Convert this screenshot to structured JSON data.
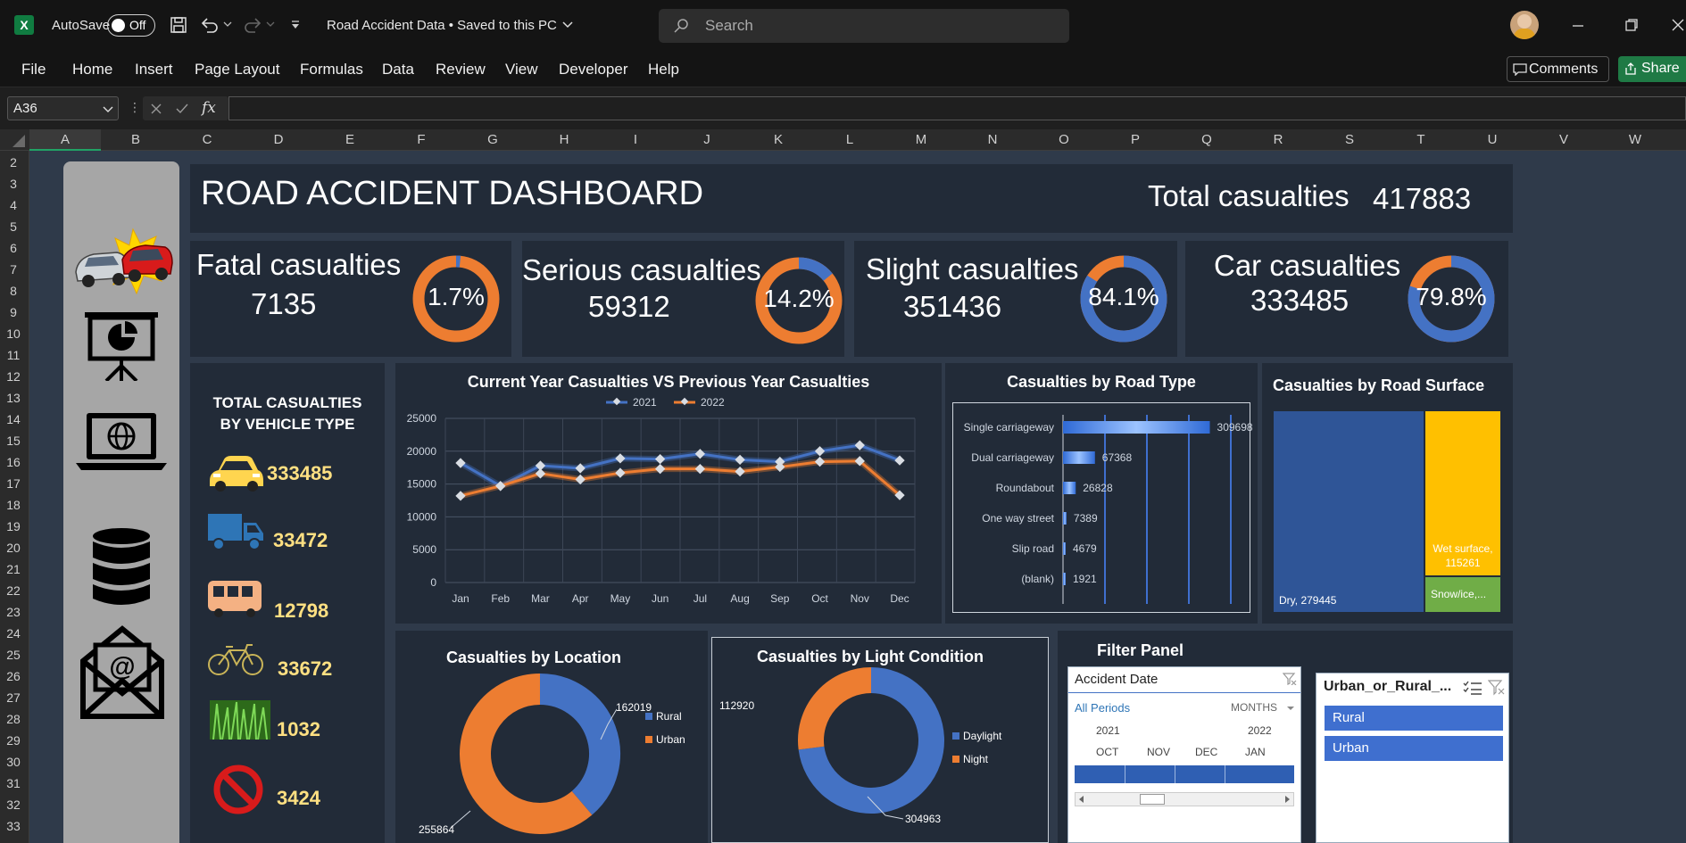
{
  "titlebar": {
    "app_icon": "excel-icon",
    "autosave_label": "AutoSave",
    "autosave_state": "Off",
    "doc_title": "Road Accident Data • Saved to this PC",
    "search_placeholder": "Search"
  },
  "ribbon": {
    "menu": [
      "File",
      "Home",
      "Insert",
      "Page Layout",
      "Formulas",
      "Data",
      "Review",
      "View",
      "Developer",
      "Help"
    ],
    "comments_label": "Comments",
    "share_label": "Share"
  },
  "formula": {
    "name_box": "A36",
    "fx": "fx",
    "value": ""
  },
  "columns": [
    "A",
    "B",
    "C",
    "D",
    "E",
    "F",
    "G",
    "H",
    "I",
    "J",
    "K",
    "L",
    "M",
    "N",
    "O",
    "P",
    "Q",
    "R",
    "S",
    "T",
    "U",
    "V",
    "W"
  ],
  "rows": [
    "2",
    "3",
    "4",
    "5",
    "6",
    "7",
    "8",
    "9",
    "10",
    "11",
    "12",
    "13",
    "14",
    "15",
    "16",
    "17",
    "18",
    "19",
    "20",
    "21",
    "22",
    "23",
    "24",
    "25",
    "26",
    "27",
    "28",
    "29",
    "30",
    "31",
    "32",
    "33"
  ],
  "dashboard": {
    "title": "ROAD ACCIDENT DASHBOARD",
    "total_label": "Total casualties",
    "total_value": "417883",
    "kpis": [
      {
        "label": "Fatal casualties",
        "value": "7135",
        "pct_label": "1.7%",
        "pct": 1.7
      },
      {
        "label": "Serious casualties",
        "value": "59312",
        "pct_label": "14.2%",
        "pct": 14.2
      },
      {
        "label": "Slight casualties",
        "value": "351436",
        "pct_label": "84.1%",
        "pct": 84.1
      },
      {
        "label": "Car casualties",
        "value": "333485",
        "pct_label": "79.8%",
        "pct": 79.8
      }
    ],
    "vehicle_title_1": "TOTAL CASUALTIES",
    "vehicle_title_2": "BY VEHICLE TYPE",
    "vehicles": [
      {
        "icon": "car-icon",
        "value": "333485"
      },
      {
        "icon": "truck-icon",
        "value": "33472"
      },
      {
        "icon": "bus-icon",
        "value": "12798"
      },
      {
        "icon": "bicycle-icon",
        "value": "33672"
      },
      {
        "icon": "grass-icon",
        "value": "1032"
      },
      {
        "icon": "no-entry-icon",
        "value": "3424"
      }
    ],
    "sidebar_icons": [
      "car-crash-icon",
      "presentation-icon",
      "laptop-globe-icon",
      "database-icon",
      "email-icon"
    ],
    "filter": {
      "title": "Filter Panel",
      "date_title": "Accident Date",
      "all_periods": "All Periods",
      "months": "MONTHS",
      "year1": "2021",
      "year2": "2022",
      "month_labels": [
        "OCT",
        "NOV",
        "DEC",
        "JAN"
      ],
      "urban_title": "Urban_or_Rural_...",
      "urban_items": [
        "Rural",
        "Urban"
      ]
    }
  },
  "colors": {
    "blue": "#4472c4",
    "orange": "#ed7d31",
    "yellow": "#ffc000",
    "green": "#70ad47",
    "panel": "#222b38",
    "sheet": "#2f3a4a"
  },
  "chart_data": [
    {
      "type": "line",
      "title": "Current Year Casualties VS Previous Year Casualties",
      "categories": [
        "Jan",
        "Feb",
        "Mar",
        "Apr",
        "May",
        "Jun",
        "Jul",
        "Aug",
        "Sep",
        "Oct",
        "Nov",
        "Dec"
      ],
      "series": [
        {
          "name": "2021",
          "color": "#4472c4",
          "values": [
            18200,
            14700,
            17800,
            17400,
            18900,
            18800,
            19600,
            18700,
            18400,
            20000,
            20900,
            18600
          ]
        },
        {
          "name": "2022",
          "color": "#ed7d31",
          "values": [
            13200,
            14700,
            16600,
            15700,
            16700,
            17300,
            17300,
            16900,
            17600,
            18400,
            18500,
            13300
          ]
        }
      ],
      "yticks": [
        "0",
        "5000",
        "10000",
        "15000",
        "20000",
        "25000"
      ],
      "ylim": [
        0,
        25000
      ],
      "legend": "top"
    },
    {
      "type": "bar",
      "title": "Casualties by Road Type",
      "categories": [
        "Single carriageway",
        "Dual carriageway",
        "Roundabout",
        "One way street",
        "Slip road",
        "(blank)"
      ],
      "values": [
        309698,
        67368,
        26828,
        7389,
        4679,
        1921
      ],
      "orientation": "horizontal"
    },
    {
      "type": "heatmap",
      "title": "Casualties by Road Surface",
      "labels": [
        "Dry, 279445",
        "Wet surface, 115261",
        "Snow/ice,..."
      ],
      "values": [
        279445,
        115261,
        23177
      ],
      "colors": [
        "#2f5597",
        "#ffc000",
        "#70ad47"
      ]
    },
    {
      "type": "pie",
      "title": "Casualties by Location",
      "labels": [
        "Rural",
        "Urban"
      ],
      "values": [
        162019,
        255864
      ],
      "value_labels": [
        "162019",
        "255864"
      ],
      "colors": [
        "#4472c4",
        "#ed7d31"
      ],
      "legend": "right"
    },
    {
      "type": "pie",
      "title": "Casualties by Light Condition",
      "labels": [
        "Daylight",
        "Night"
      ],
      "values": [
        304963,
        112920
      ],
      "value_labels": [
        "304963",
        "112920"
      ],
      "colors": [
        "#4472c4",
        "#ed7d31"
      ],
      "legend": "right"
    }
  ]
}
